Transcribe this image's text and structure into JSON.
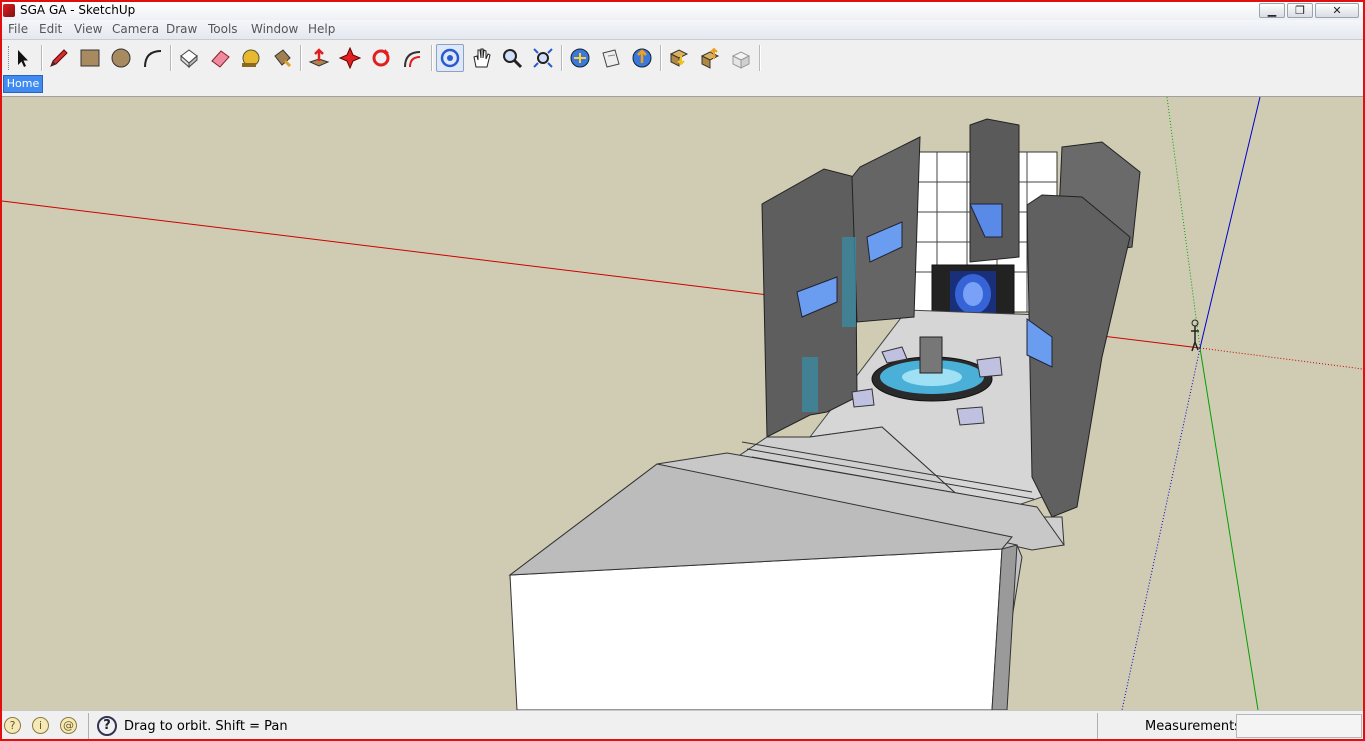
{
  "window": {
    "title": "SGA GA - SketchUp"
  },
  "menu": [
    "File",
    "Edit",
    "View",
    "Camera",
    "Draw",
    "Tools",
    "Window",
    "Help"
  ],
  "toolbar": {
    "tools": [
      "select-icon",
      "pencil-icon",
      "rectangle-icon",
      "circle-icon",
      "arc-icon",
      "make-component-icon",
      "eraser-icon",
      "tape-measure-icon",
      "paint-bucket-icon",
      "push-pull-icon",
      "move-icon",
      "rotate-icon",
      "offset-icon",
      "orbit-icon",
      "pan-icon",
      "zoom-icon",
      "zoom-extents-icon",
      "get-models-icon",
      "share-model-icon",
      "preview-in-google-earth-icon",
      "get-photo-texture-icon",
      "share-component-icon",
      "create-component-icon"
    ],
    "active_tool": "orbit-icon"
  },
  "scenes": {
    "tabs": [
      "Home"
    ],
    "active": "Home"
  },
  "status": {
    "message": "Drag to orbit.  Shift = Pan",
    "measurements_label": "Measurements",
    "measurements_value": ""
  },
  "colors": {
    "background": "#d0ccb4",
    "red_axis": "#cc0000",
    "green_axis": "#00a000",
    "blue_axis": "#0000cc",
    "tab_active": "#3f8bf0"
  }
}
